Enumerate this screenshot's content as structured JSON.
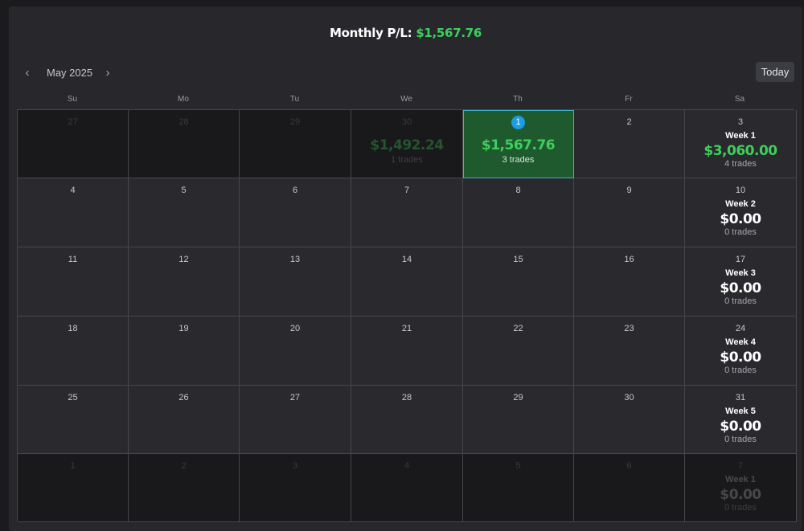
{
  "header": {
    "label": "Monthly P/L:",
    "value": "$1,567.76"
  },
  "nav": {
    "prev_icon": "‹",
    "month": "May 2025",
    "next_icon": "›",
    "today": "Today"
  },
  "weekdays": [
    "Su",
    "Mo",
    "Tu",
    "We",
    "Th",
    "Fr",
    "Sa"
  ],
  "weeks": [
    {
      "days": [
        {
          "n": "27",
          "out": true
        },
        {
          "n": "28",
          "out": true
        },
        {
          "n": "29",
          "out": true
        },
        {
          "n": "30",
          "out": true,
          "pnl": "$1,492.24",
          "trades": "1 trades"
        },
        {
          "n": "1",
          "active": true,
          "pnl": "$1,567.76",
          "trades": "3 trades"
        },
        {
          "n": "2"
        },
        {
          "n": "3",
          "week": "Week 1",
          "pnl": "$3,060.00",
          "trades": "4 trades",
          "green": true
        }
      ]
    },
    {
      "days": [
        {
          "n": "4"
        },
        {
          "n": "5"
        },
        {
          "n": "6"
        },
        {
          "n": "7"
        },
        {
          "n": "8"
        },
        {
          "n": "9"
        },
        {
          "n": "10",
          "week": "Week 2",
          "pnl": "$0.00",
          "trades": "0 trades"
        }
      ]
    },
    {
      "days": [
        {
          "n": "11"
        },
        {
          "n": "12"
        },
        {
          "n": "13"
        },
        {
          "n": "14"
        },
        {
          "n": "15"
        },
        {
          "n": "16"
        },
        {
          "n": "17",
          "week": "Week 3",
          "pnl": "$0.00",
          "trades": "0 trades"
        }
      ]
    },
    {
      "days": [
        {
          "n": "18"
        },
        {
          "n": "19"
        },
        {
          "n": "20"
        },
        {
          "n": "21"
        },
        {
          "n": "22"
        },
        {
          "n": "23"
        },
        {
          "n": "24",
          "week": "Week 4",
          "pnl": "$0.00",
          "trades": "0 trades"
        }
      ]
    },
    {
      "days": [
        {
          "n": "25"
        },
        {
          "n": "26"
        },
        {
          "n": "27"
        },
        {
          "n": "28"
        },
        {
          "n": "29"
        },
        {
          "n": "30"
        },
        {
          "n": "31",
          "week": "Week 5",
          "pnl": "$0.00",
          "trades": "0 trades"
        }
      ]
    },
    {
      "days": [
        {
          "n": "1",
          "out": true
        },
        {
          "n": "2",
          "out": true
        },
        {
          "n": "3",
          "out": true
        },
        {
          "n": "4",
          "out": true
        },
        {
          "n": "5",
          "out": true
        },
        {
          "n": "6",
          "out": true
        },
        {
          "n": "7",
          "out": true,
          "week": "Week 1",
          "pnl": "$0.00",
          "trades": "0 trades"
        }
      ]
    }
  ],
  "colors": {
    "accent": "#3ecf5e",
    "badge": "#1d9be3",
    "active_cell": "#1f5a2e",
    "active_border": "#3bb5c9"
  }
}
